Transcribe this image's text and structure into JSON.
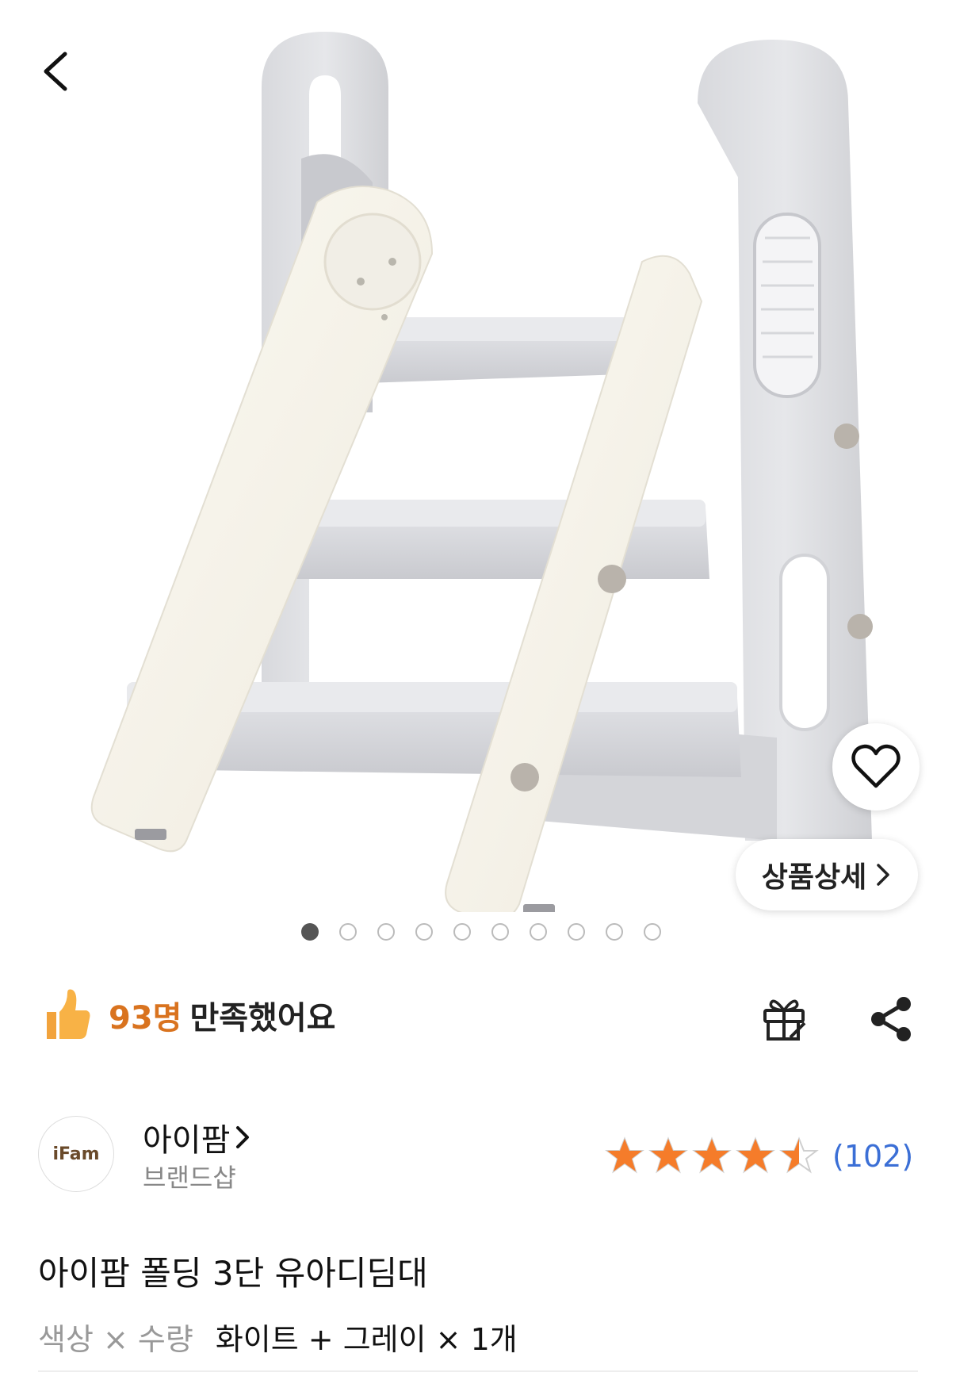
{
  "hero": {
    "wishlist_icon": "heart-outline-icon",
    "back_icon": "chevron-left-icon",
    "detail_button_label": "상품상세",
    "detail_button_icon": "chevron-right-icon",
    "image_count": 10,
    "active_image_index": 0
  },
  "satisfaction": {
    "icon": "thumbs-up-icon",
    "count": "93명",
    "text": "만족했어요",
    "count_color": "#d9731f"
  },
  "actions": {
    "gift_icon": "gift-icon",
    "share_icon": "share-icon"
  },
  "brand": {
    "logo_text": "iFam",
    "name": "아이팜",
    "name_icon": "chevron-right-icon",
    "subtitle": "브랜드샵",
    "rating_stars": 4.5,
    "review_count": "(102)",
    "star_color": "#f57c2a",
    "review_color": "#3b6fd6"
  },
  "product": {
    "title": "아이팜 폴딩 3단 유아디딤대",
    "option_label": "색상 × 수량",
    "option_value": "화이트 + 그레이 × 1개"
  }
}
